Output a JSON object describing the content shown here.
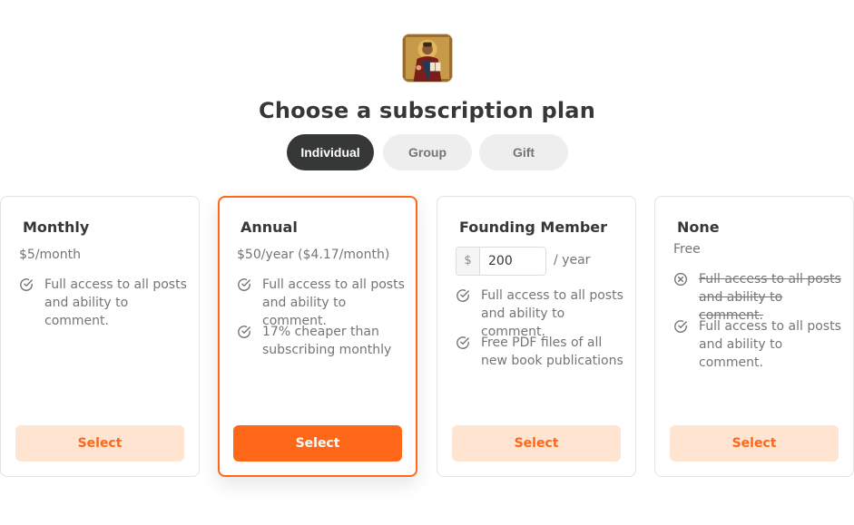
{
  "header": {
    "logo_icon": "icon-painting-logo",
    "title": "Choose a subscription plan"
  },
  "tabs": [
    {
      "label": "Individual",
      "active": true
    },
    {
      "label": "Group",
      "active": false
    },
    {
      "label": "Gift",
      "active": false
    }
  ],
  "plans": [
    {
      "name": "Monthly",
      "price": "$5/month",
      "selected": false,
      "features": [
        {
          "icon": "check-circle-icon",
          "text": "Full access to all posts and ability to comment."
        }
      ],
      "button_label": "Select"
    },
    {
      "name": "Annual",
      "price": "$50/year ($4.17/month)",
      "selected": true,
      "features": [
        {
          "icon": "check-circle-icon",
          "text": "Full access to all posts and ability to comment."
        },
        {
          "icon": "check-circle-icon",
          "text": "17% cheaper than subscribing monthly"
        }
      ],
      "button_label": "Select"
    },
    {
      "name": "Founding Member",
      "amount_prefix": "$",
      "amount_value": "200",
      "amount_suffix": "/ year",
      "selected": false,
      "features": [
        {
          "icon": "check-circle-icon",
          "text": "Full access to all posts and ability to comment."
        },
        {
          "icon": "check-circle-icon",
          "text": "Free PDF files of all new book publications"
        }
      ],
      "button_label": "Select"
    },
    {
      "name": "None",
      "price": "Free",
      "selected": false,
      "features": [
        {
          "icon": "x-circle-icon",
          "text": "Full access to all posts and ability to comment.",
          "struck": true
        },
        {
          "icon": "check-circle-icon",
          "text": "Full access to all posts and ability to comment."
        }
      ],
      "button_label": "Select"
    }
  ],
  "colors": {
    "accent": "#ff6719",
    "accent_light": "#ffe4d2",
    "text_dark": "#363737",
    "text_muted": "#757575"
  }
}
